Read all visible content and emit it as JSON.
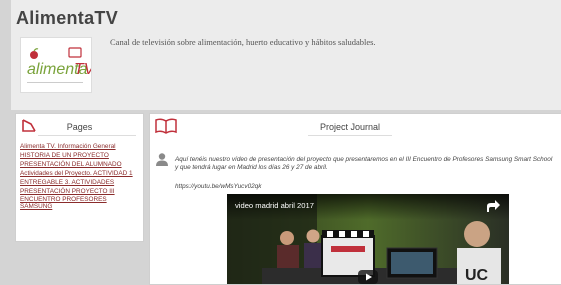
{
  "site": {
    "title": "AlimentaTV",
    "description": "Canal de televisión sobre alimentación, huerto educativo y hábitos saludables.",
    "logo_text": "alimentaTV"
  },
  "pages_panel": {
    "title": "Pages",
    "items": [
      "Alimenta TV. Información General",
      "HISTORIA DE UN PROYECTO",
      "PRESENTACIÓN DEL ALUMNADO",
      "Actividades del Proyecto. ACTIVIDAD 1",
      "ENTREGABLE 3. ACTIVIDADES",
      "PRESENTACIÓN PROYECTO III ENCUENTRO PROFESORES SAMSUNG"
    ]
  },
  "journal_panel": {
    "title": "Project Journal",
    "post": {
      "text": "Aquí tenéis nuestro vídeo de presentación del proyecto que presentaremos en el III Encuentro de Profesores Samsung Smart School y que tendrá lugar en Madrid los días 26 y 27 de abril.",
      "link": "https://youtu.be/wMsYucv02qk"
    },
    "video": {
      "title": "video madrid abril 2017"
    }
  },
  "colors": {
    "accent": "#c0303b",
    "link": "#8a2b2b",
    "logo_green": "#7aa33b"
  },
  "icons": [
    "pages-icon",
    "book-icon",
    "user-avatar-icon",
    "share-icon",
    "play-icon"
  ]
}
